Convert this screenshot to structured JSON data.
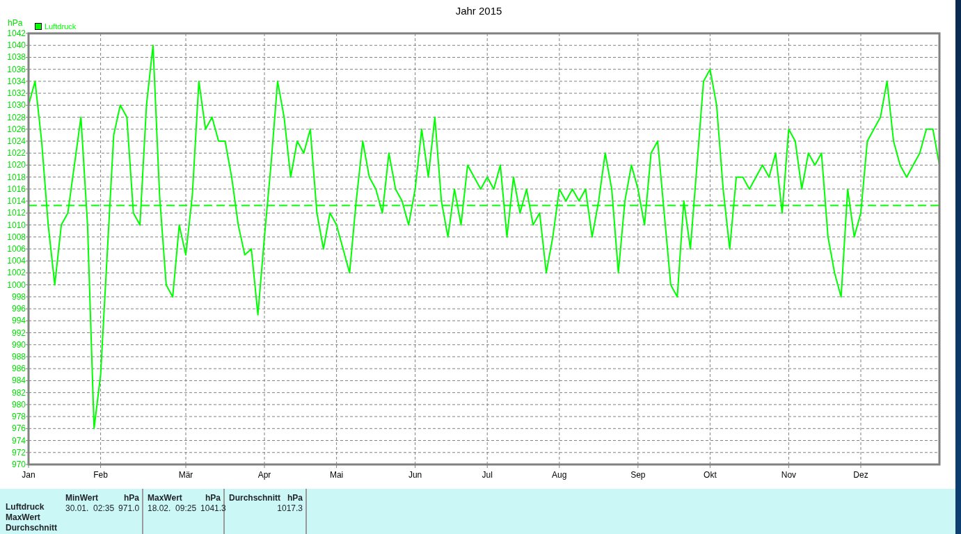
{
  "title": "Jahr 2015",
  "chart": {
    "chart_data": {
      "type": "line",
      "ylabel": "hPa",
      "categories": [
        "Jan",
        null,
        null,
        null,
        null,
        null,
        null,
        null,
        null,
        null,
        null,
        "Feb",
        null,
        null,
        null,
        null,
        null,
        null,
        null,
        null,
        null,
        null,
        null,
        null,
        "Mär",
        null,
        null,
        null,
        null,
        null,
        null,
        null,
        null,
        null,
        null,
        null,
        "Apr",
        null,
        null,
        null,
        null,
        null,
        null,
        null,
        null,
        null,
        null,
        "Mai",
        null,
        null,
        null,
        null,
        null,
        null,
        null,
        null,
        null,
        null,
        null,
        "Jun",
        null,
        null,
        null,
        null,
        null,
        null,
        null,
        null,
        null,
        null,
        "Jul",
        null,
        null,
        null,
        null,
        null,
        null,
        null,
        null,
        null,
        null,
        "Aug",
        null,
        null,
        null,
        null,
        null,
        null,
        null,
        null,
        null,
        null,
        null,
        "Sep",
        null,
        null,
        null,
        null,
        null,
        null,
        null,
        null,
        null,
        null,
        "Okt",
        null,
        null,
        null,
        null,
        null,
        null,
        null,
        null,
        null,
        null,
        null,
        "Nov",
        null,
        null,
        null,
        null,
        null,
        null,
        null,
        null,
        null,
        null,
        "Dez",
        null,
        null,
        null,
        null,
        null,
        null,
        null,
        null,
        null,
        null,
        null,
        null
      ],
      "series": [
        {
          "name": "Luftdruck",
          "color": "#00ff00",
          "values": [
            1030,
            1034,
            1024,
            1010,
            1000,
            1010,
            1012,
            1020,
            1028,
            1010,
            976,
            985,
            1005,
            1025,
            1030,
            1028,
            1012,
            1010,
            1030,
            1040,
            1015,
            1000,
            998,
            1010,
            1005,
            1015,
            1034,
            1026,
            1028,
            1024,
            1024,
            1018,
            1010,
            1005,
            1006,
            995,
            1008,
            1020,
            1034,
            1028,
            1018,
            1024,
            1022,
            1026,
            1012,
            1006,
            1012,
            1010,
            1006,
            1002,
            1014,
            1024,
            1018,
            1016,
            1012,
            1022,
            1016,
            1014,
            1010,
            1016,
            1026,
            1018,
            1028,
            1014,
            1008,
            1016,
            1010,
            1020,
            1018,
            1016,
            1018,
            1016,
            1020,
            1008,
            1018,
            1012,
            1016,
            1010,
            1012,
            1002,
            1008,
            1016,
            1014,
            1016,
            1014,
            1016,
            1008,
            1014,
            1022,
            1016,
            1002,
            1014,
            1020,
            1016,
            1010,
            1022,
            1024,
            1012,
            1000,
            998,
            1014,
            1006,
            1020,
            1034,
            1036,
            1030,
            1016,
            1006,
            1018,
            1018,
            1016,
            1018,
            1020,
            1018,
            1022,
            1012,
            1026,
            1024,
            1016,
            1022,
            1020,
            1022,
            1008,
            1002,
            998,
            1016,
            1008,
            1012,
            1024,
            1026,
            1028,
            1034,
            1024,
            1020,
            1018,
            1020,
            1022,
            1026,
            1026,
            1020
          ]
        }
      ],
      "ylim": [
        970,
        1042
      ],
      "grid": true,
      "yticks": [
        970,
        972,
        974,
        976,
        978,
        980,
        982,
        984,
        986,
        988,
        990,
        992,
        994,
        996,
        998,
        1000,
        1002,
        1004,
        1006,
        1008,
        1010,
        1012,
        1014,
        1016,
        1018,
        1020,
        1022,
        1024,
        1026,
        1028,
        1030,
        1032,
        1034,
        1036,
        1038,
        1040,
        1042
      ],
      "ref_lines": [
        {
          "axis": "y",
          "value": 1013.25
        }
      ]
    }
  },
  "stats": {
    "row_labels": [
      "Luftdruck",
      "MaxWert",
      "Durchschnitt"
    ],
    "columns": [
      {
        "heading": "MinWert",
        "unit": "hPa",
        "time": "30.01.  02:35",
        "value": "971.0"
      },
      {
        "heading": "MaxWert",
        "unit": "hPa",
        "time": "18.02.  09:25",
        "value": "1041.3"
      },
      {
        "heading": "Durchschnitt",
        "unit": "hPa",
        "value": "1017.3"
      }
    ]
  }
}
